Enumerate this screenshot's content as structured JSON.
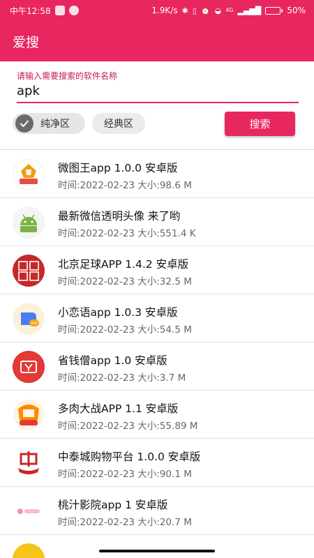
{
  "status_bar": {
    "time": "中午12:58",
    "net_speed": "1.9K/s",
    "network": "4G",
    "battery_text": "50%",
    "battery_level": 0.5
  },
  "app_bar": {
    "title": "爱搜"
  },
  "search": {
    "label": "请输入需要搜索的软件名称",
    "value": "apk",
    "button_label": "搜索"
  },
  "filters": [
    {
      "label": "纯净区",
      "selected": true
    },
    {
      "label": "经典区",
      "selected": false
    }
  ],
  "apps": [
    {
      "title": "微图王app 1.0.0 安卓版",
      "meta": "时间:2022-02-23 大小:98.6 M",
      "icon": "weituwang-icon"
    },
    {
      "title": "最新微信透明头像  来了哟",
      "meta": "时间:2022-02-23 大小:551.4 K",
      "icon": "android-icon"
    },
    {
      "title": "北京足球APP 1.4.2 安卓版",
      "meta": "时间:2022-02-23 大小:32.5 M",
      "icon": "beijing-football-icon"
    },
    {
      "title": "小恋语app 1.0.3 安卓版",
      "meta": "时间:2022-02-23 大小:54.5 M",
      "icon": "chat-bubble-icon"
    },
    {
      "title": "省钱僧app 1.0 安卓版",
      "meta": "时间:2022-02-23 大小:3.7 M",
      "icon": "coupon-icon"
    },
    {
      "title": "多肉大战APP 1.1 安卓版",
      "meta": "时间:2022-02-23 大小:55.89 M",
      "icon": "plant-war-icon"
    },
    {
      "title": "中泰城购物平台 1.0.0 安卓版",
      "meta": "时间:2022-02-23 大小:90.1 M",
      "icon": "zhongtai-icon"
    },
    {
      "title": "桃汁影院app 1 安卓版",
      "meta": "时间:2022-02-23 大小:20.7 M",
      "icon": "peach-cinema-icon"
    }
  ]
}
